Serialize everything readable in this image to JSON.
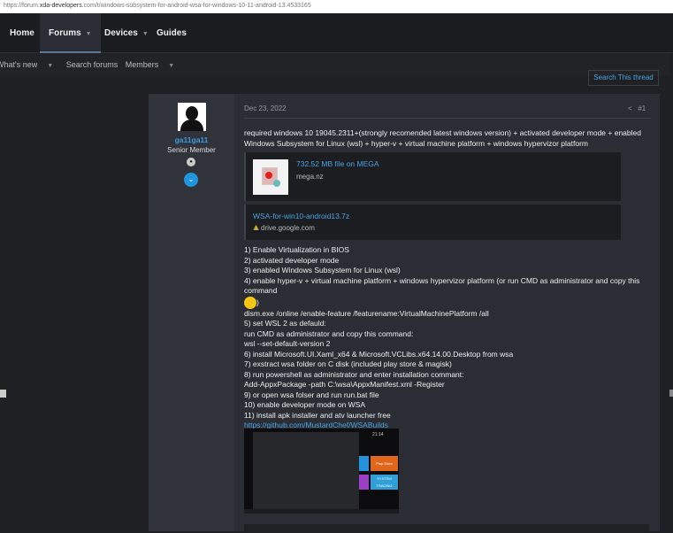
{
  "url": {
    "prefix": "https://forum.",
    "domain": "xda-developers",
    "rest": ".com/t/windows-subsystem-for-android-wsa-for-windows-10-11-android-13.4533165"
  },
  "nav": {
    "items": [
      {
        "label": "Home"
      },
      {
        "label": "Forums"
      },
      {
        "label": "Devices"
      },
      {
        "label": "Guides"
      }
    ],
    "caret": "▼"
  },
  "subnav": {
    "items": [
      {
        "label": "What's new"
      },
      {
        "label": "Search forums"
      },
      {
        "label": "Members"
      }
    ]
  },
  "search_thread": "Search This thread",
  "post": {
    "user": {
      "name": "ga11ga11",
      "role": "Senior Member"
    },
    "date": "Dec 23, 2022",
    "number": "#1",
    "intro": "required windows 10 19045.2311+(strongly recomended latest windows version) + activated developer mode + enabled Windows Subsystem for Linux (wsl) + hyper-v + virtual machine platform + windows hypervizor platform",
    "embeds": [
      {
        "title": "732.52 MB file on MEGA",
        "domain": "mega.nz"
      },
      {
        "title": "WSA-for-win10-android13.7z",
        "domain": "drive.google.com"
      }
    ],
    "steps": [
      "1) Enable Virtualization in BIOS",
      "2) activated developer mode",
      "3) enabled Windows Subsystem for Linux (wsl)",
      "4) enable hyper-v + virtual machine platform + windows hypervizor platform (or run CMD as administrator and copy this command",
      ")",
      "dism.exe /online /enable-feature /featurename:VirtualMachinePlatform /all",
      "5) set WSL 2 as defauld:",
      "run CMD as administrator and copy this command:",
      "wsl --set-default-version 2",
      "6) install Microsoft.UI.Xaml_x64 & Microsoft.VCLibs.x64.14.00.Desktop from wsa",
      "7) exstract wsa folder on C disk (included play store & magisk)",
      "8) run powershell as administrator and enter installation commant:",
      "Add-AppxPackage -path C:\\wsa\\AppxManifest.xml -Register",
      "9) or open wsa folser and run run.bat file",
      "10) enable developer mode on WSA",
      "11) install apk installer and atv launcher free"
    ],
    "link": "https://github.com/MustardChef/WSABuilds",
    "screenshot": {
      "clock": "21:14",
      "tile1": "Play Store",
      "tile2": "SYSTEM TRACING"
    }
  }
}
